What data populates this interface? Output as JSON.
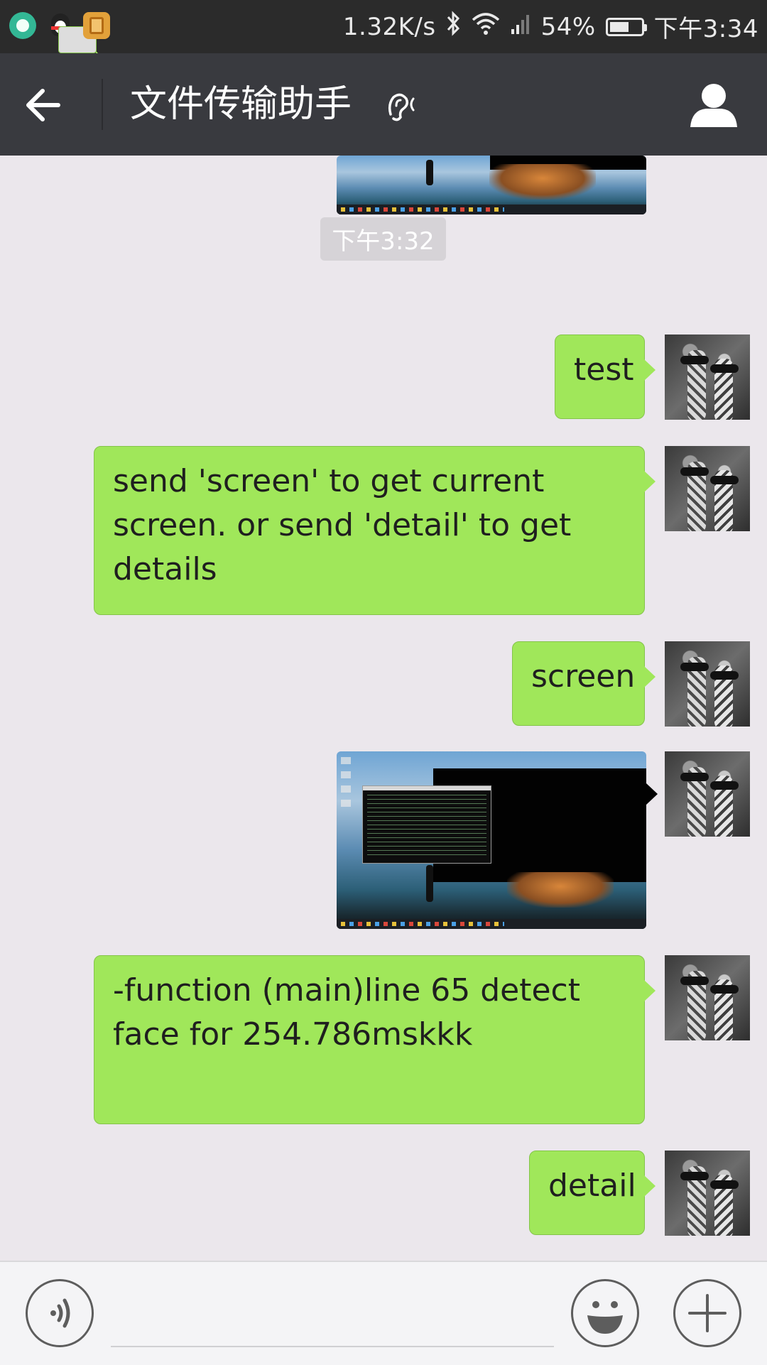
{
  "status_bar": {
    "net_speed": "1.32K/s",
    "battery": "54%",
    "battery_level": 0.54,
    "time": "下午3:34",
    "notification_icons": [
      "app-icon",
      "qq-icon",
      "document-app-icon"
    ]
  },
  "header": {
    "title": "文件传输助手",
    "back_icon": "arrow-left-icon",
    "mode_icon": "ear-icon",
    "profile_icon": "person-icon"
  },
  "chat": {
    "timestamp": "下午3:32",
    "messages": [
      {
        "type": "image",
        "from": "me"
      },
      {
        "type": "text",
        "from": "me",
        "text": "test"
      },
      {
        "type": "text",
        "from": "me",
        "text": "send 'screen' to get current screen. or send 'detail' to get details"
      },
      {
        "type": "text",
        "from": "me",
        "text": "screen"
      },
      {
        "type": "image",
        "from": "me"
      },
      {
        "type": "text",
        "from": "me",
        "text": "-function (main)line 65 detect face for 254.786mskkk"
      },
      {
        "type": "text",
        "from": "me",
        "text": "detail"
      }
    ]
  },
  "input_bar": {
    "voice_icon": "voice-icon",
    "emoji_icon": "emoji-icon",
    "plus_icon": "plus-icon",
    "text_value": ""
  },
  "colors": {
    "status_bar": "#2b2b2b",
    "title_bar": "#393a3f",
    "chat_background": "#ebe7ec",
    "bubble": "#a0e75a",
    "timestamp_pill": "#d6d3d7"
  }
}
